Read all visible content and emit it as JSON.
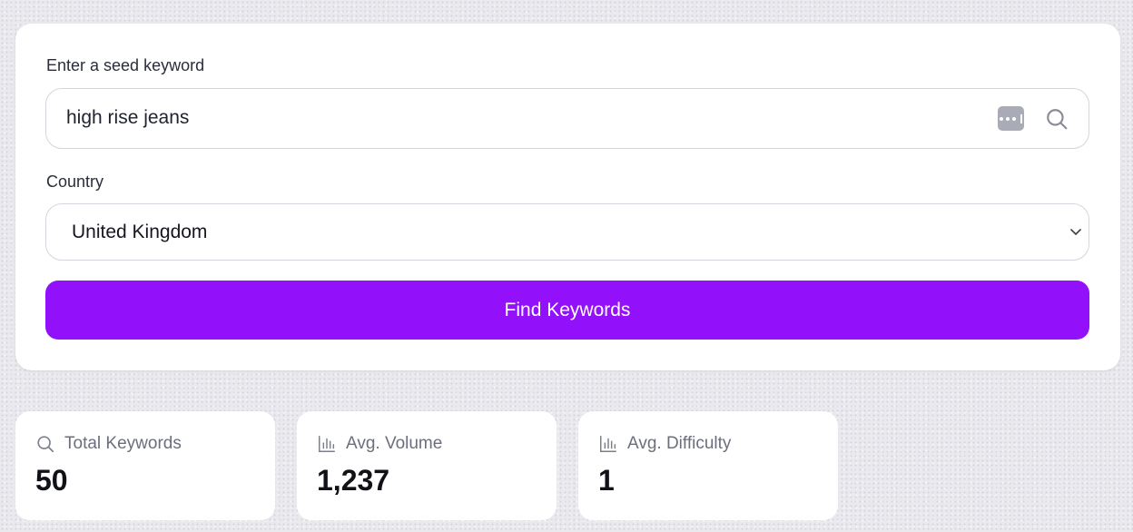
{
  "form": {
    "seed_label": "Enter a seed keyword",
    "seed_value": "high rise jeans",
    "country_label": "Country",
    "country_value": "United Kingdom",
    "submit_label": "Find Keywords"
  },
  "stats": [
    {
      "label": "Total Keywords",
      "value": "50",
      "icon": "search-icon"
    },
    {
      "label": "Avg. Volume",
      "value": "1,237",
      "icon": "bar-chart-icon"
    },
    {
      "label": "Avg. Difficulty",
      "value": "1",
      "icon": "bar-chart-icon"
    }
  ],
  "colors": {
    "accent": "#9310fb",
    "card_bg": "#ffffff",
    "muted_text": "#6b6f7d"
  }
}
